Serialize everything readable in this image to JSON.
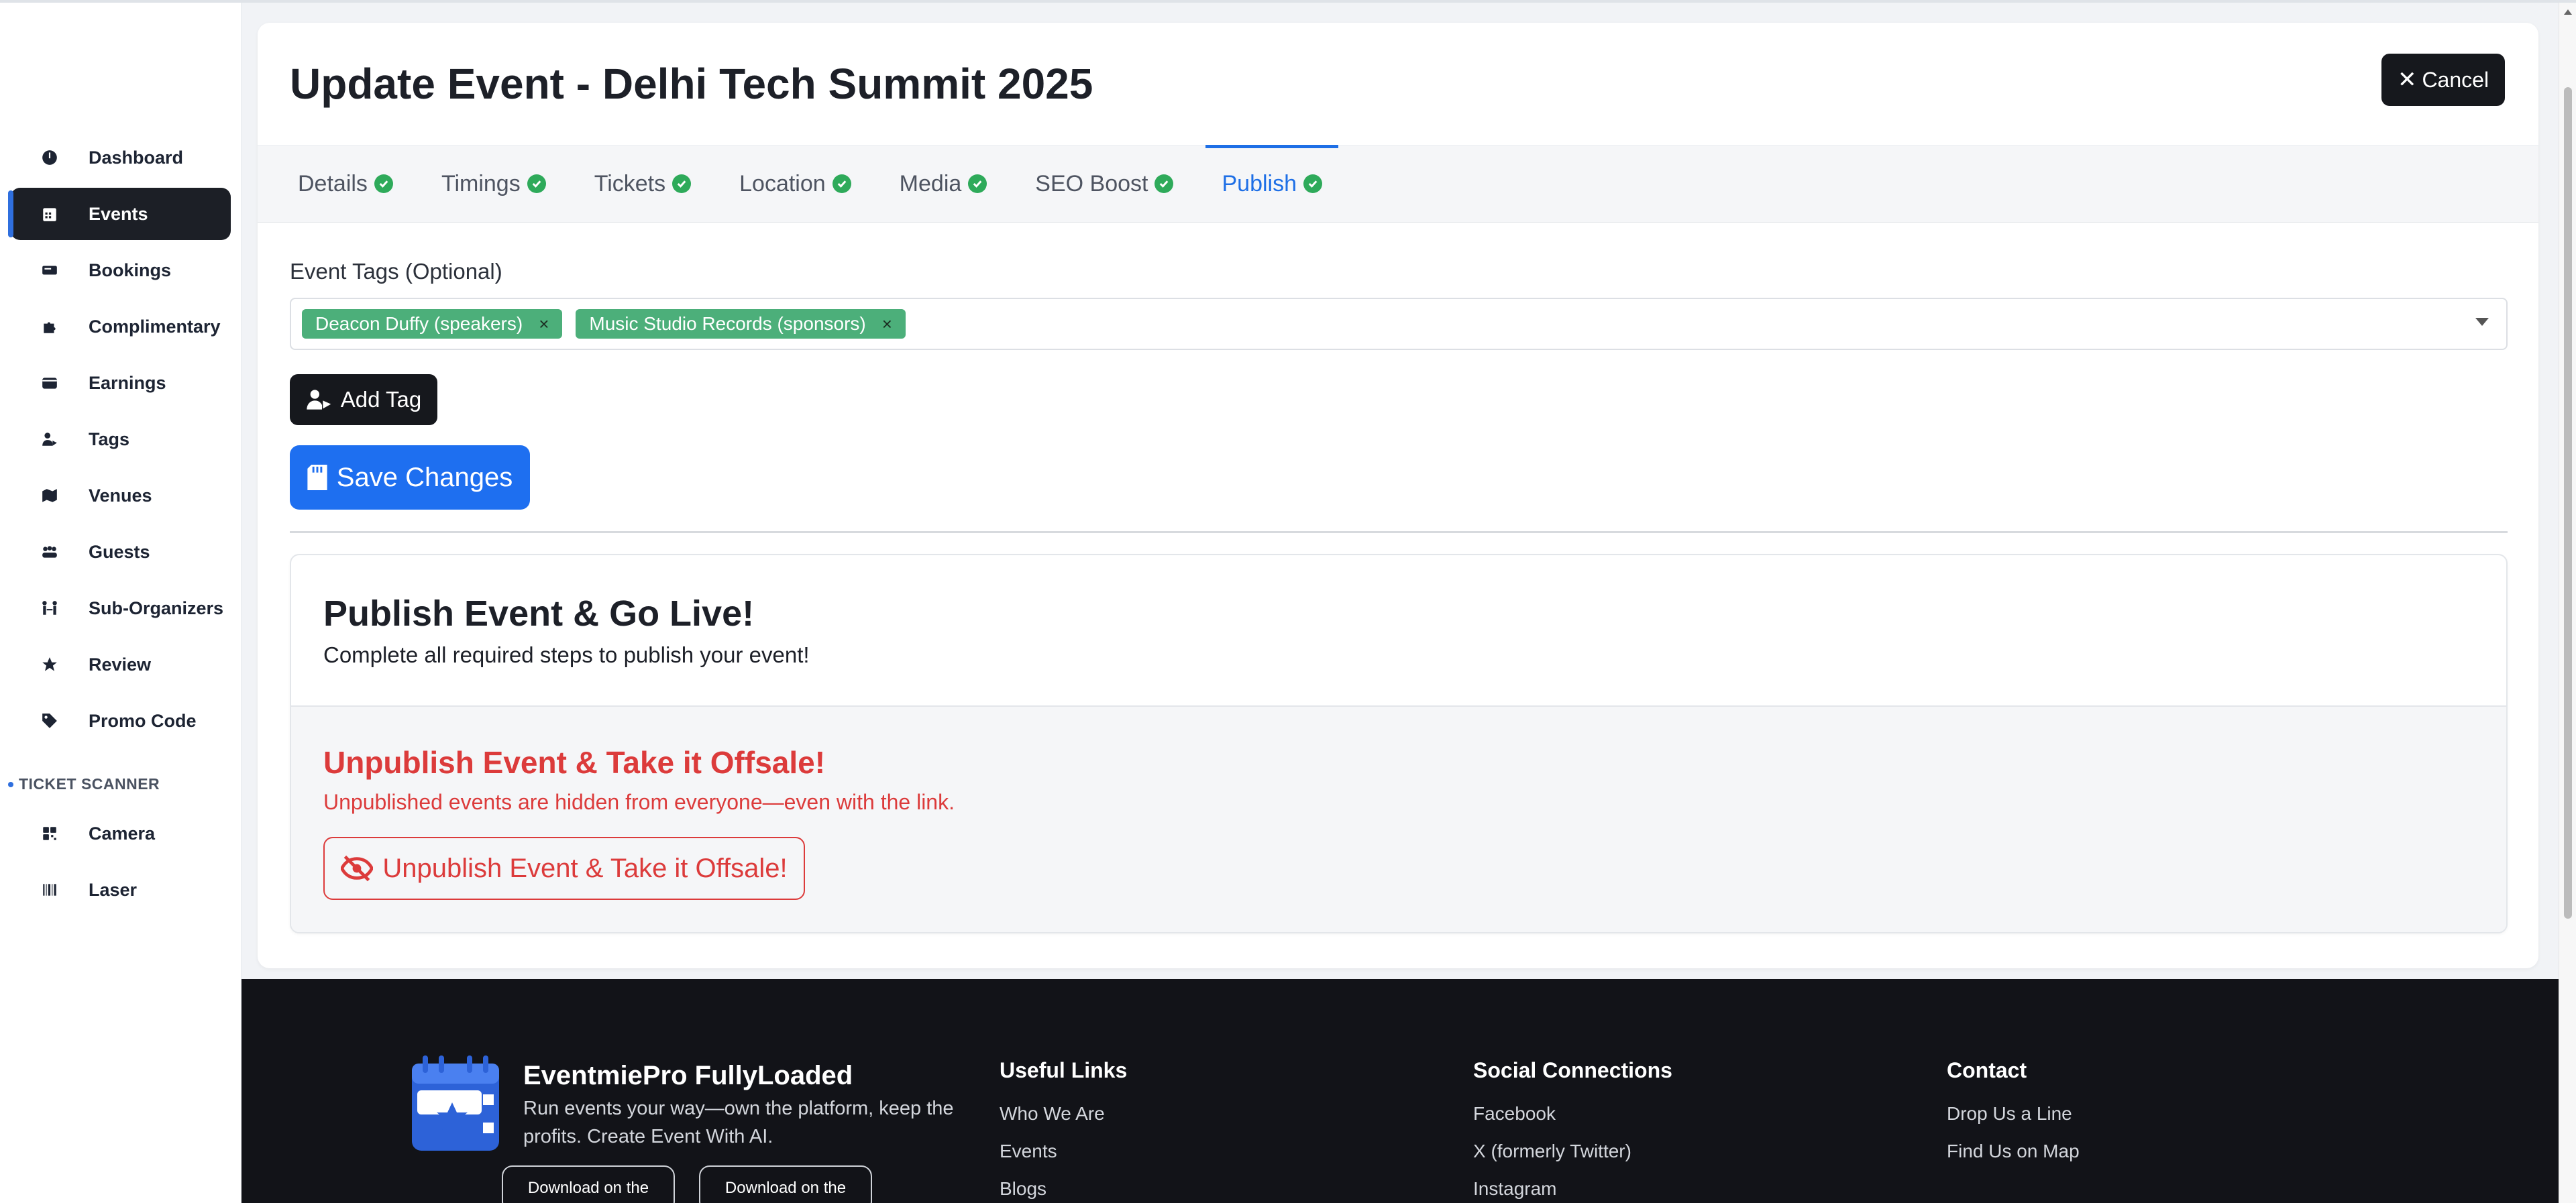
{
  "sidebar": {
    "items": [
      {
        "label": "Dashboard",
        "icon": "gauge-icon"
      },
      {
        "label": "Events",
        "icon": "calendar-icon"
      },
      {
        "label": "Bookings",
        "icon": "ticket-icon"
      },
      {
        "label": "Complimentary",
        "icon": "puzzle-icon"
      },
      {
        "label": "Earnings",
        "icon": "wallet-icon"
      },
      {
        "label": "Tags",
        "icon": "user-tag-icon"
      },
      {
        "label": "Venues",
        "icon": "map-icon"
      },
      {
        "label": "Guests",
        "icon": "users-icon"
      },
      {
        "label": "Sub-Organizers",
        "icon": "people-arrows-icon"
      },
      {
        "label": "Review",
        "icon": "star-icon"
      },
      {
        "label": "Promo Code",
        "icon": "tag-icon"
      }
    ],
    "active": "Events",
    "section_label": "TICKET SCANNER",
    "scanner_items": [
      {
        "label": "Camera",
        "icon": "qrcode-icon"
      },
      {
        "label": "Laser",
        "icon": "barcode-icon"
      }
    ]
  },
  "header": {
    "title": "Update Event - Delhi Tech Summit 2025",
    "cancel_label": "Cancel"
  },
  "tabs": [
    {
      "label": "Details",
      "complete": true
    },
    {
      "label": "Timings",
      "complete": true
    },
    {
      "label": "Tickets",
      "complete": true
    },
    {
      "label": "Location",
      "complete": true
    },
    {
      "label": "Media",
      "complete": true
    },
    {
      "label": "SEO Boost",
      "complete": true
    },
    {
      "label": "Publish",
      "complete": true
    }
  ],
  "active_tab": "Publish",
  "form": {
    "tags_label": "Event Tags (Optional)",
    "tags": [
      "Deacon Duffy (speakers)",
      "Music Studio Records (sponsors)"
    ],
    "tag_remove_glyph": "×",
    "add_tag_label": "Add Tag",
    "save_label": "Save Changes"
  },
  "publish": {
    "title": "Publish Event & Go Live!",
    "subtitle": "Complete all required steps to publish your event!",
    "unpublish_title": "Unpublish Event & Take it Offsale!",
    "unpublish_subtitle": "Unpublished events are hidden from everyone—even with the link.",
    "unpublish_button": "Unpublish Event & Take it Offsale!"
  },
  "footer": {
    "brand": "EventmiePro FullyLoaded",
    "tagline": "Run events your way—own the platform, keep the profits. Create Event With AI.",
    "store_buttons": [
      "Download on the",
      "Download on the"
    ],
    "columns": [
      {
        "title": "Useful Links",
        "links": [
          "Who We Are",
          "Events",
          "Blogs"
        ]
      },
      {
        "title": "Social Connections",
        "links": [
          "Facebook",
          "X (formerly Twitter)",
          "Instagram"
        ]
      },
      {
        "title": "Contact",
        "links": [
          "Drop Us a Line",
          "Find Us on Map"
        ]
      }
    ]
  },
  "colors": {
    "primary": "#1e6ff0",
    "dark": "#16181d",
    "success": "#2eaa5a",
    "danger": "#dc3b3b",
    "tag": "#4caf7a"
  }
}
